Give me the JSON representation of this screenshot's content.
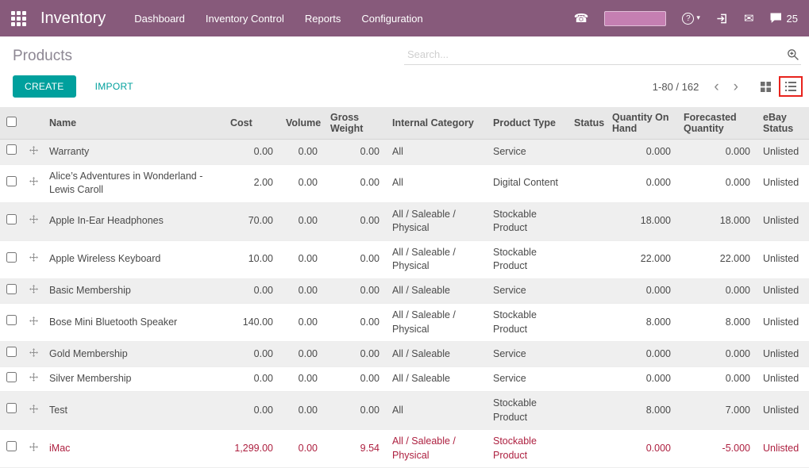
{
  "colors": {
    "topbar": "#875A7B",
    "accent": "#00A09D",
    "danger": "#AD1F3F"
  },
  "topbar": {
    "app_title": "Inventory",
    "menu": [
      "Dashboard",
      "Inventory Control",
      "Reports",
      "Configuration"
    ],
    "icons": {
      "phone": "☎",
      "help": "?",
      "caret": "▾",
      "mail": "✉"
    },
    "messages_count": "25"
  },
  "page": {
    "title": "Products"
  },
  "search": {
    "placeholder": "Search..."
  },
  "toolbar": {
    "create_label": "CREATE",
    "import_label": "IMPORT",
    "pager": "1-80 / 162",
    "prev": "‹",
    "next": "›"
  },
  "table": {
    "columns": [
      "Name",
      "Cost",
      "Volume",
      "Gross Weight",
      "Internal Category",
      "Product Type",
      "Status",
      "Quantity On Hand",
      "Forecasted Quantity",
      "eBay Status"
    ],
    "rows": [
      {
        "name": "Warranty",
        "cost": "0.00",
        "volume": "0.00",
        "gross_weight": "0.00",
        "internal_category": "All",
        "product_type": "Service",
        "status": "",
        "qty_on_hand": "0.000",
        "forecasted_qty": "0.000",
        "ebay_status": "Unlisted",
        "danger": false
      },
      {
        "name": "Alice’s Adventures in Wonderland - Lewis Caroll",
        "cost": "2.00",
        "volume": "0.00",
        "gross_weight": "0.00",
        "internal_category": "All",
        "product_type": "Digital Content",
        "status": "",
        "qty_on_hand": "0.000",
        "forecasted_qty": "0.000",
        "ebay_status": "Unlisted",
        "danger": false
      },
      {
        "name": "Apple In-Ear Headphones",
        "cost": "70.00",
        "volume": "0.00",
        "gross_weight": "0.00",
        "internal_category": "All / Saleable / Physical",
        "product_type": "Stockable Product",
        "status": "",
        "qty_on_hand": "18.000",
        "forecasted_qty": "18.000",
        "ebay_status": "Unlisted",
        "danger": false
      },
      {
        "name": "Apple Wireless Keyboard",
        "cost": "10.00",
        "volume": "0.00",
        "gross_weight": "0.00",
        "internal_category": "All / Saleable / Physical",
        "product_type": "Stockable Product",
        "status": "",
        "qty_on_hand": "22.000",
        "forecasted_qty": "22.000",
        "ebay_status": "Unlisted",
        "danger": false
      },
      {
        "name": "Basic Membership",
        "cost": "0.00",
        "volume": "0.00",
        "gross_weight": "0.00",
        "internal_category": "All / Saleable",
        "product_type": "Service",
        "status": "",
        "qty_on_hand": "0.000",
        "forecasted_qty": "0.000",
        "ebay_status": "Unlisted",
        "danger": false
      },
      {
        "name": "Bose Mini Bluetooth Speaker",
        "cost": "140.00",
        "volume": "0.00",
        "gross_weight": "0.00",
        "internal_category": "All / Saleable / Physical",
        "product_type": "Stockable Product",
        "status": "",
        "qty_on_hand": "8.000",
        "forecasted_qty": "8.000",
        "ebay_status": "Unlisted",
        "danger": false
      },
      {
        "name": "Gold Membership",
        "cost": "0.00",
        "volume": "0.00",
        "gross_weight": "0.00",
        "internal_category": "All / Saleable",
        "product_type": "Service",
        "status": "",
        "qty_on_hand": "0.000",
        "forecasted_qty": "0.000",
        "ebay_status": "Unlisted",
        "danger": false
      },
      {
        "name": "Silver Membership",
        "cost": "0.00",
        "volume": "0.00",
        "gross_weight": "0.00",
        "internal_category": "All / Saleable",
        "product_type": "Service",
        "status": "",
        "qty_on_hand": "0.000",
        "forecasted_qty": "0.000",
        "ebay_status": "Unlisted",
        "danger": false
      },
      {
        "name": "Test",
        "cost": "0.00",
        "volume": "0.00",
        "gross_weight": "0.00",
        "internal_category": "All",
        "product_type": "Stockable Product",
        "status": "",
        "qty_on_hand": "8.000",
        "forecasted_qty": "7.000",
        "ebay_status": "Unlisted",
        "danger": false
      },
      {
        "name": "iMac",
        "cost": "1,299.00",
        "volume": "0.00",
        "gross_weight": "9.54",
        "internal_category": "All / Saleable / Physical",
        "product_type": "Stockable Product",
        "status": "",
        "qty_on_hand": "0.000",
        "forecasted_qty": "-5.000",
        "ebay_status": "Unlisted",
        "danger": true
      }
    ]
  }
}
